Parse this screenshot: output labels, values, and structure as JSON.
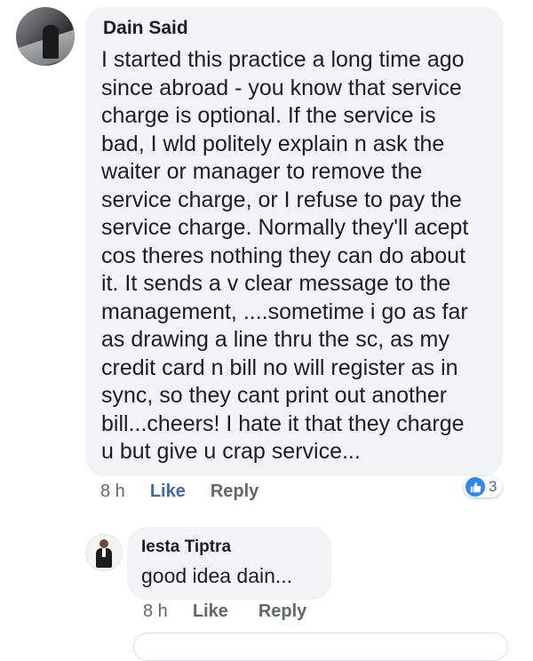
{
  "comments": [
    {
      "author": "Dain Said",
      "text": "I started this practice a long time ago\nsince abroad - you know that service\ncharge is optional. If the service is\nbad, I wld politely explain n ask the\nwaiter  or manager to remove the\nservice charge, or I refuse to pay the\nservice charge. Normally they'll acept\ncos theres nothing they can do about\nit. It sends a v clear message to the\nmanagement, ....sometime i go as far\nas drawing a line thru the sc, as my\ncredit card n bill no will register as in\nsync, so they cant print out another\nbill...cheers! I hate it that they charge\nu but give u crap service...",
      "time": "8 h",
      "like_label": "Like",
      "reply_label": "Reply",
      "reactions": {
        "icon": "thumbs-up-icon",
        "count": "3",
        "color": "#2d88ff"
      }
    },
    {
      "author": "Iesta Tiptra",
      "text": "good idea dain...",
      "time": "8 h",
      "like_label": "Like",
      "reply_label": "Reply"
    }
  ],
  "colors": {
    "bubble": "#f2f3f5",
    "text": "#1c1e21",
    "meta": "#606770",
    "like_active": "#4267b2"
  }
}
